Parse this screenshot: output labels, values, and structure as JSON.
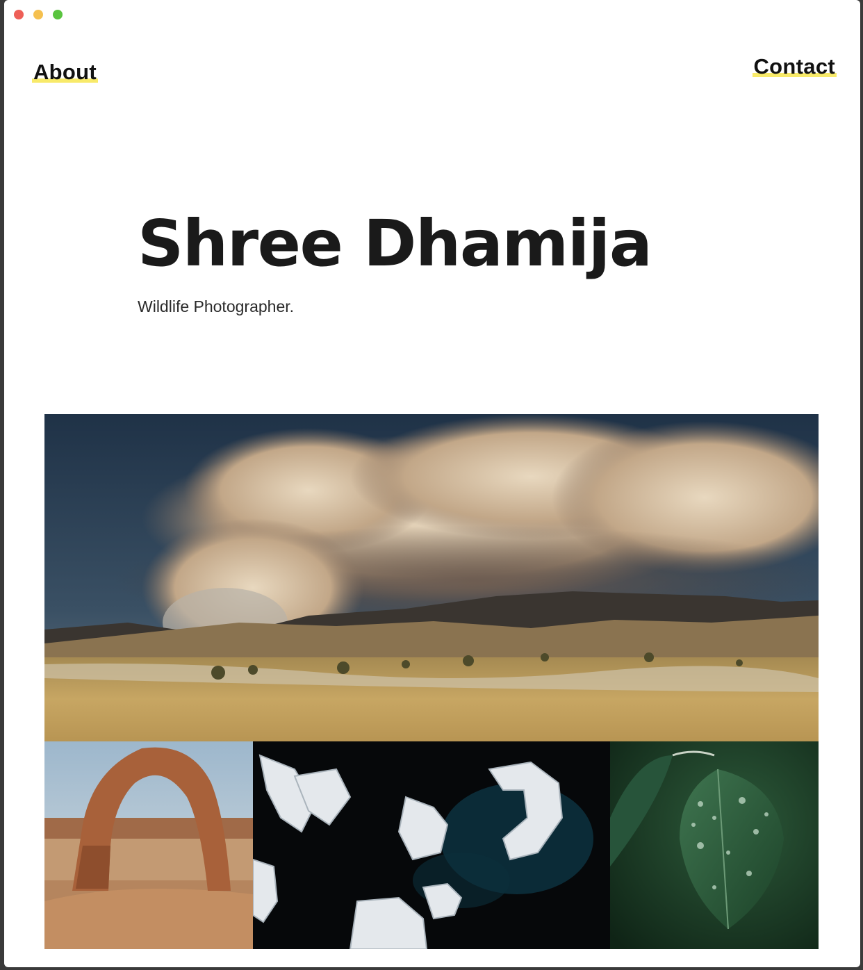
{
  "window": {
    "controls": [
      "close",
      "minimize",
      "maximize"
    ]
  },
  "nav": {
    "about_label": "About",
    "contact_label": "Contact",
    "underline_color": "#f8ea6a"
  },
  "hero": {
    "name": "Shree Dhamija",
    "subtitle": "Wildlife Photographer."
  },
  "gallery": {
    "photos": [
      {
        "subject": "smoke cloud over desert hills"
      },
      {
        "subject": "sandstone arch"
      },
      {
        "subject": "icebergs in dark water"
      },
      {
        "subject": "green leaf with water droplets"
      }
    ]
  }
}
